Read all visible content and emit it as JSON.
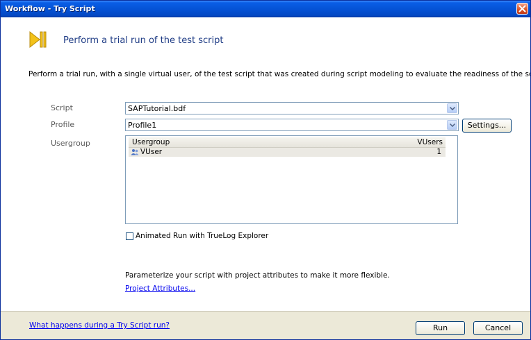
{
  "window": {
    "title": "Workflow - Try Script"
  },
  "header": {
    "title": "Perform a trial run of the test script"
  },
  "description": "Perform a trial run, with a single virtual user, of the test script that was created during script modeling to evaluate the readiness of the script.",
  "form": {
    "script_label": "Script",
    "script_value": "SAPTutorial.bdf",
    "profile_label": "Profile",
    "profile_value": "Profile1",
    "settings_label": "Settings...",
    "usergroup_label": "Usergroup"
  },
  "usergroup_table": {
    "columns": [
      "Usergroup",
      "VUsers"
    ],
    "rows": [
      {
        "name": "VUser",
        "vusers": "1"
      }
    ]
  },
  "animated_run": {
    "label": "Animated Run with TrueLog Explorer",
    "checked": false
  },
  "parameterize": {
    "text": "Parameterize your script with project attributes to make it more flexible.",
    "link": "Project Attributes..."
  },
  "footer": {
    "help_link": "What happens during a Try Script run?",
    "run_label": "Run",
    "cancel_label": "Cancel"
  },
  "colors": {
    "titlebar": "#0553d6",
    "header_text": "#1f3c85",
    "footer_bg": "#ece9d8",
    "icon": "#f3c21a"
  }
}
